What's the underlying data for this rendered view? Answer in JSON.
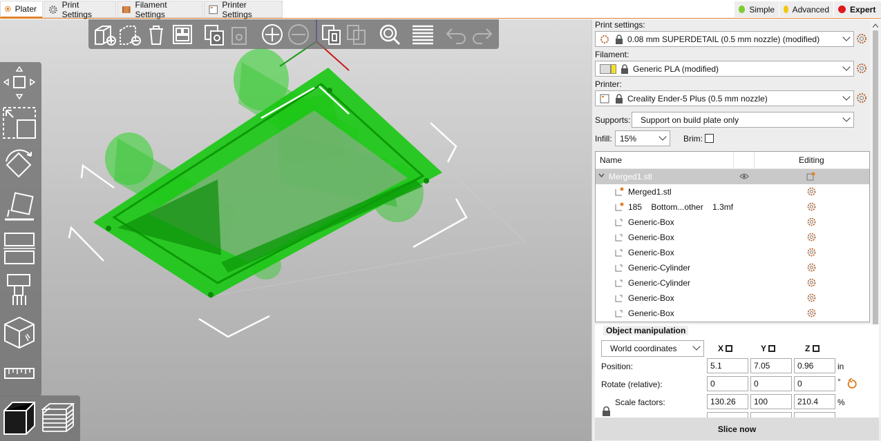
{
  "tabs": [
    {
      "label": "Plater",
      "active": true
    },
    {
      "label": "Print Settings",
      "active": false
    },
    {
      "label": "Filament Settings",
      "active": false
    },
    {
      "label": "Printer Settings",
      "active": false
    }
  ],
  "modes": [
    {
      "label": "Simple",
      "color": "#7dcc33"
    },
    {
      "label": "Advanced",
      "color": "#f2c60c"
    },
    {
      "label": "Expert",
      "color": "#e0181e"
    }
  ],
  "colors": {
    "accent": "#e0812a",
    "model_green": "#22c31a"
  },
  "sidebar": {
    "print_settings_label": "Print settings:",
    "print_settings_value": "0.08 mm SUPERDETAIL (0.5 mm nozzle) (modified)",
    "filament_label": "Filament:",
    "filament_value": "Generic PLA (modified)",
    "printer_label": "Printer:",
    "printer_value": "Creality Ender-5 Plus (0.5 mm nozzle)",
    "supports_label": "Supports:",
    "supports_value": "Support on build plate only",
    "infill_label": "Infill:",
    "infill_value": "15%",
    "brim_label": "Brim:",
    "brim_checked": false
  },
  "object_list": {
    "col_name": "Name",
    "col_editing": "Editing",
    "rows": [
      {
        "name": "Merged1.stl",
        "selected": true
      },
      {
        "name": "Merged1.stl"
      },
      {
        "name": "185    Bottom...other    1.3mf"
      },
      {
        "name": "Generic-Box"
      },
      {
        "name": "Generic-Box"
      },
      {
        "name": "Generic-Box"
      },
      {
        "name": "Generic-Cylinder"
      },
      {
        "name": "Generic-Cylinder"
      },
      {
        "name": "Generic-Box"
      },
      {
        "name": "Generic-Box"
      }
    ]
  },
  "manip": {
    "title": "Object manipulation",
    "coords": "World coordinates",
    "x": "X",
    "y": "Y",
    "z": "Z",
    "position_label": "Position:",
    "position": [
      "5.1",
      "7.05",
      "0.96"
    ],
    "position_unit": "in",
    "rotate_label": "Rotate (relative):",
    "rotate": [
      "0",
      "0",
      "0"
    ],
    "rotate_unit": "°",
    "scale_label": "Scale factors:",
    "scale": [
      "130.26",
      "100",
      "210.4"
    ],
    "scale_unit": "%"
  },
  "slice_label": "Slice now"
}
